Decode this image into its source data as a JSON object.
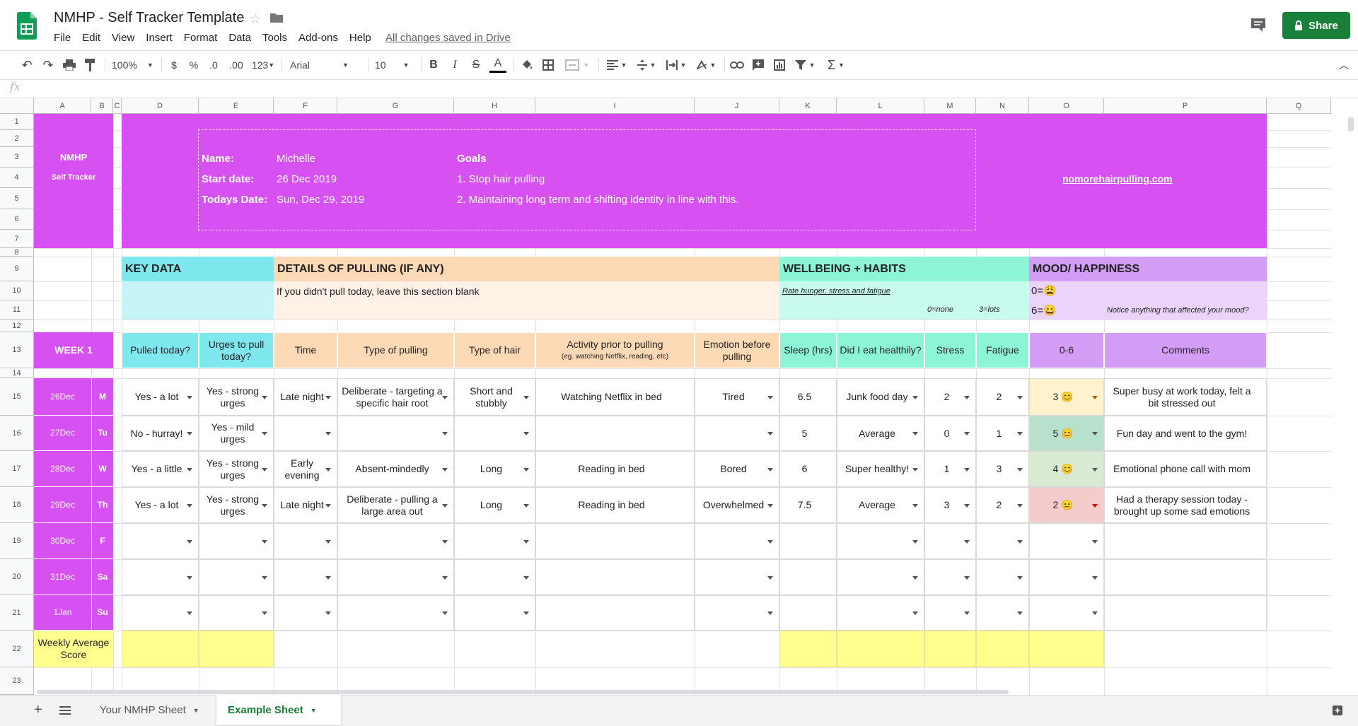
{
  "app": {
    "title": "NMHP - Self Tracker Template",
    "menu": [
      "File",
      "Edit",
      "View",
      "Insert",
      "Format",
      "Data",
      "Tools",
      "Add-ons",
      "Help"
    ],
    "save_status": "All changes saved in Drive",
    "share_label": "Share"
  },
  "toolbar": {
    "zoom": "100%",
    "currency": "$",
    "percent": "%",
    "decimal_less": ".0",
    "decimal_more": ".00",
    "number_format": "123",
    "font": "Arial",
    "font_size": "10",
    "bold": "B",
    "italic": "I",
    "strike": "S",
    "text_color": "A"
  },
  "formula_bar": {
    "fx": "fx",
    "value": ""
  },
  "columns": [
    "A",
    "B",
    "C",
    "D",
    "E",
    "F",
    "G",
    "H",
    "I",
    "J",
    "K",
    "L",
    "M",
    "N",
    "O",
    "P",
    "Q"
  ],
  "rows": [
    "1",
    "2",
    "3",
    "4",
    "5",
    "6",
    "7",
    "8",
    "9",
    "10",
    "11",
    "12",
    "13",
    "14",
    "15",
    "16",
    "17",
    "18",
    "19",
    "20",
    "21",
    "22",
    "23"
  ],
  "banner": {
    "nmhp": "NMHP",
    "self_tracker": "Self Tracker",
    "name_label": "Name:",
    "name_value": "Michelle",
    "start_label": "Start date:",
    "start_value": "26 Dec 2019",
    "today_label": "Todays Date:",
    "today_value": "Sun, Dec 29, 2019",
    "goals_label": "Goals",
    "goal1": "1. Stop hair pulling",
    "goal2": "2. Maintaining long term and shifting identity in line with this.",
    "website": "nomorehairpulling.com"
  },
  "sections": {
    "key_data": "KEY DATA",
    "details": "DETAILS OF PULLING (IF ANY)",
    "details_note": "If you didn't pull today, leave this section blank",
    "wellbeing": "WELLBEING + HABITS",
    "wellbeing_note": "Rate hunger, stress and fatigue",
    "scale_none": "0=none",
    "scale_lots": "3=lots",
    "mood": "MOOD/ HAPPINESS",
    "mood_0": "0=😩",
    "mood_6": "6=😀",
    "mood_note": "Notice anything that affected your mood?"
  },
  "table": {
    "week": "WEEK 1",
    "headers": [
      "Pulled today?",
      "Urges to pull today?",
      "Time",
      "Type of pulling",
      "Type of hair",
      "Activity prior to pulling",
      "Emotion before pulling",
      "Sleep (hrs)",
      "Did I eat healthily?",
      "Stress",
      "Fatigue",
      "0-6",
      "Comments"
    ],
    "activity_sub": "(eg. watching Netflix, reading, etc)",
    "days": [
      {
        "date": "26Dec",
        "dow": "M",
        "pulled": "Yes - a lot",
        "urges": "Yes - strong urges",
        "time": "Late night",
        "type": "Deliberate - targeting a specific hair root",
        "hair": "Short and stubbly",
        "activity": "Watching Netflix in bed",
        "emotion": "Tired",
        "sleep": "6.5",
        "eat": "Junk food day",
        "stress": "2",
        "fatigue": "2",
        "mood": "3 😊",
        "comment": "Super busy at work today, felt a bit stressed out"
      },
      {
        "date": "27Dec",
        "dow": "Tu",
        "pulled": "No - hurray!",
        "urges": "Yes - mild urges",
        "time": "",
        "type": "",
        "hair": "",
        "activity": "",
        "emotion": "",
        "sleep": "5",
        "eat": "Average",
        "stress": "0",
        "fatigue": "1",
        "mood": "5 😊",
        "comment": "Fun day and went to the gym!"
      },
      {
        "date": "28Dec",
        "dow": "W",
        "pulled": "Yes - a little",
        "urges": "Yes - strong urges",
        "time": "Early evening",
        "type": "Absent-mindedly",
        "hair": "Long",
        "activity": "Reading in bed",
        "emotion": "Bored",
        "sleep": "6",
        "eat": "Super healthy!",
        "stress": "1",
        "fatigue": "3",
        "mood": "4 😊",
        "comment": "Emotional phone call with mom"
      },
      {
        "date": "29Dec",
        "dow": "Th",
        "pulled": "Yes - a lot",
        "urges": "Yes - strong urges",
        "time": "Late night",
        "type": "Deliberate - pulling a large area out",
        "hair": "Long",
        "activity": "Reading in bed",
        "emotion": "Overwhelmed",
        "sleep": "7.5",
        "eat": "Average",
        "stress": "3",
        "fatigue": "2",
        "mood": "2 😐",
        "comment": "Had a therapy session today - brought up some sad emotions"
      },
      {
        "date": "30Dec",
        "dow": "F",
        "pulled": "",
        "urges": "",
        "time": "",
        "type": "",
        "hair": "",
        "activity": "",
        "emotion": "",
        "sleep": "",
        "eat": "",
        "stress": "",
        "fatigue": "",
        "mood": "",
        "comment": ""
      },
      {
        "date": "31Dec",
        "dow": "Sa",
        "pulled": "",
        "urges": "",
        "time": "",
        "type": "",
        "hair": "",
        "activity": "",
        "emotion": "",
        "sleep": "",
        "eat": "",
        "stress": "",
        "fatigue": "",
        "mood": "",
        "comment": ""
      },
      {
        "date": "1Jan",
        "dow": "Su",
        "pulled": "",
        "urges": "",
        "time": "",
        "type": "",
        "hair": "",
        "activity": "",
        "emotion": "",
        "sleep": "",
        "eat": "",
        "stress": "",
        "fatigue": "",
        "mood": "",
        "comment": ""
      }
    ],
    "weekly_avg": "Weekly Average Score"
  },
  "tabs": [
    {
      "label": "Your NMHP Sheet",
      "active": false
    },
    {
      "label": "Example Sheet",
      "active": true
    }
  ],
  "colors": {
    "purple": "#d650f2",
    "cyan": "#7fe7ee",
    "peach": "#fdd9b5",
    "mint": "#8cf5d8",
    "lavender": "#d39cf5",
    "yellow": "#ffff8d",
    "share": "#188038",
    "mood_3": "#fff2cc",
    "mood_5": "#b7e1cd",
    "mood_4": "#d9ead3",
    "mood_2": "#f4cccc"
  }
}
